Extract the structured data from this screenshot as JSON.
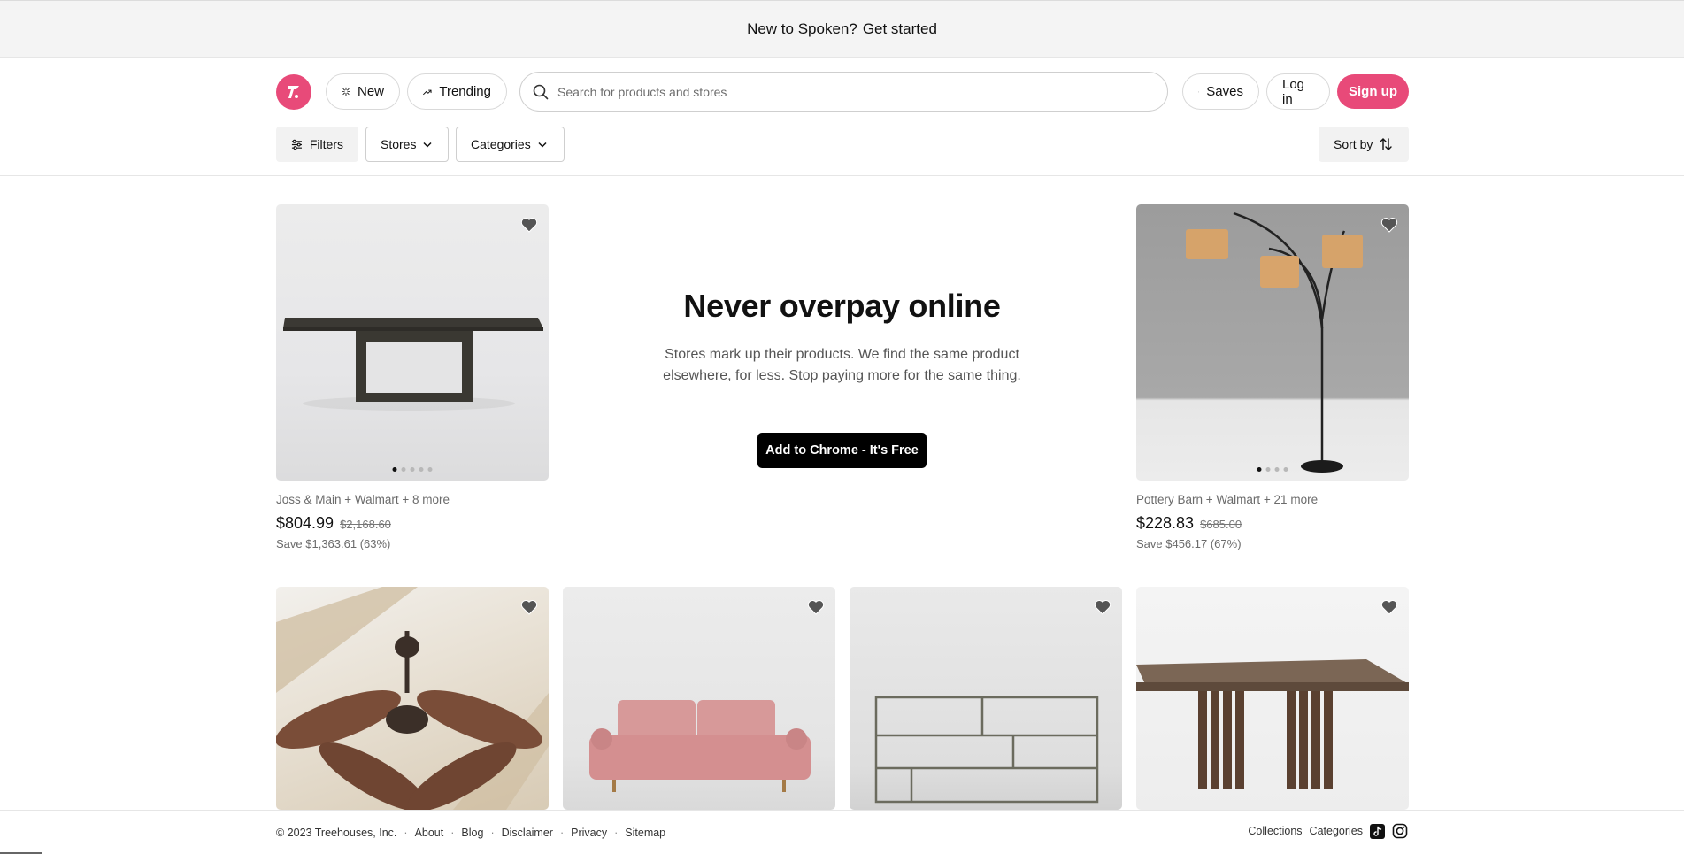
{
  "banner": {
    "text": "New to Spoken?",
    "link": "Get started"
  },
  "header": {
    "new_label": "New",
    "trending_label": "Trending",
    "search_placeholder": "Search for products and stores",
    "saves_label": "Saves",
    "login_label": "Log in",
    "signup_label": "Sign up",
    "filters_label": "Filters",
    "stores_label": "Stores",
    "categories_label": "Categories",
    "sort_label": "Sort by",
    "brand_color": "#e84a79"
  },
  "hero": {
    "title": "Never overpay online",
    "description": "Stores mark up their products. We find the same product elsewhere, for less. Stop paying more for the same thing.",
    "cta": "Add to Chrome - It's Free"
  },
  "products": [
    {
      "name": "table",
      "stores": "Joss & Main + Walmart + 8 more",
      "price": "$804.99",
      "original": "$2,168.60",
      "save": "Save $1,363.61 (63%)"
    },
    {
      "name": "lamp",
      "stores": "Pottery Barn + Walmart + 21 more",
      "price": "$228.83",
      "original": "$685.00",
      "save": "Save $456.17 (67%)"
    }
  ],
  "footer": {
    "copyright": "© 2023 Treehouses, Inc.",
    "links": [
      "About",
      "Blog",
      "Disclaimer",
      "Privacy",
      "Sitemap"
    ],
    "right_links": [
      "Collections",
      "Categories"
    ]
  }
}
